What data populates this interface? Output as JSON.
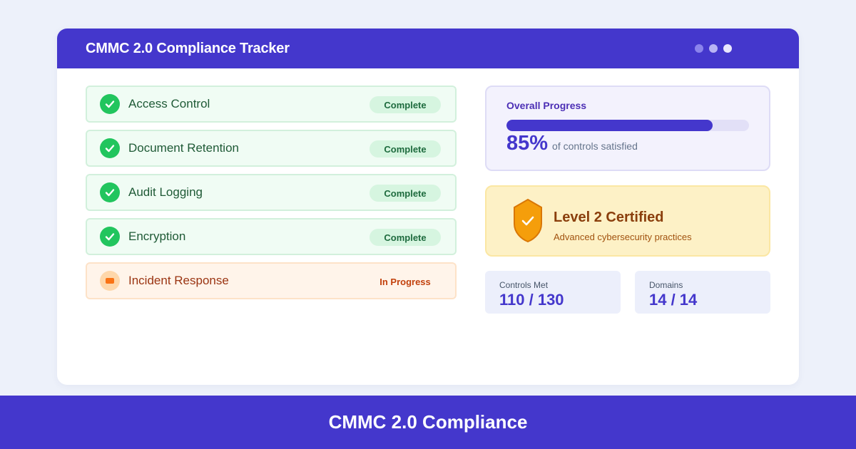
{
  "window": {
    "title": "CMMC 2.0 Compliance Tracker",
    "dots": [
      "#8b84ec",
      "#b9b4f4",
      "#e9e7fd"
    ]
  },
  "controls": [
    {
      "label": "Access Control",
      "status": "Complete"
    },
    {
      "label": "Document Retention",
      "status": "Complete"
    },
    {
      "label": "Audit Logging",
      "status": "Complete"
    },
    {
      "label": "Encryption",
      "status": "Complete"
    },
    {
      "label": "Incident Response",
      "status": "In Progress"
    }
  ],
  "progress": {
    "title": "Overall Progress",
    "percent_label": "85%",
    "percent_value": 85,
    "caption": "of controls satisfied"
  },
  "certification": {
    "title": "Level 2 Certified",
    "subtitle": "Advanced cybersecurity practices",
    "icon": "shield-check-icon"
  },
  "stats": {
    "controls_met": {
      "label": "Controls Met",
      "value": "110 / 130"
    },
    "domains": {
      "label": "Domains",
      "value": "14 / 14"
    }
  },
  "footer": {
    "title": "CMMC 2.0 Compliance"
  },
  "colors": {
    "brand": "#4437cc",
    "complete": "#22c55e",
    "in_progress": "#f97316",
    "certified": "#f59e0b"
  }
}
